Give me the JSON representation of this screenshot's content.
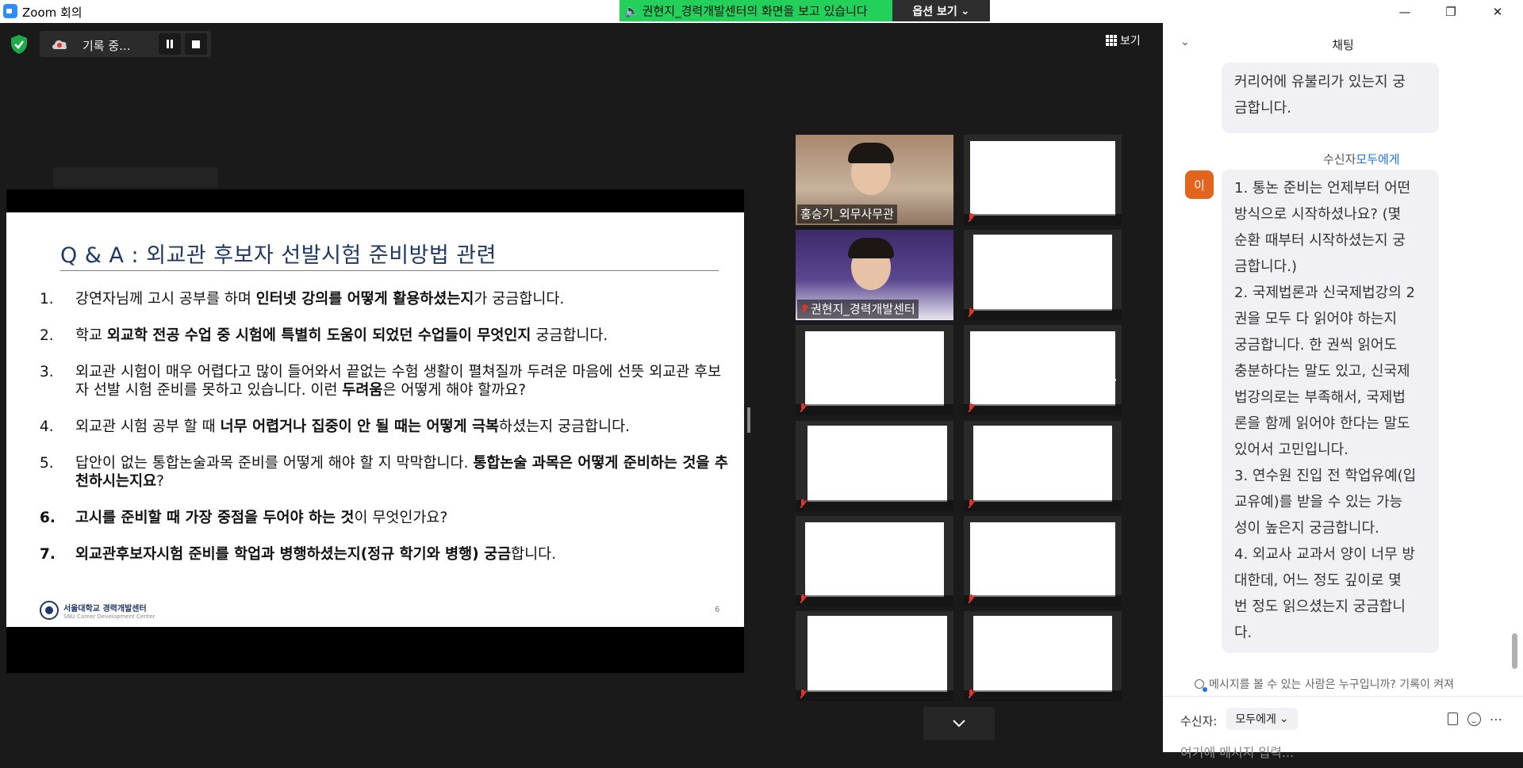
{
  "window": {
    "title": "Zoom 회의",
    "minimize": "—",
    "maximize": "❐",
    "close": "✕"
  },
  "share_banner": {
    "text": "권현지_경력개발센터의 화면을 보고 있습니다",
    "options_label": "옵션 보기"
  },
  "toolbar": {
    "recording_label": "기록 중...",
    "view_label": "보기"
  },
  "slide": {
    "title": "Q & A : 외교관 후보자 선발시험 준비방법 관련",
    "items": [
      {
        "num": "1.",
        "parts": [
          {
            "t": "강연자님께 고시 공부를 하며 ",
            "b": false
          },
          {
            "t": "인터넷 강의를 어떻게 활용하셨는지",
            "b": true
          },
          {
            "t": "가 궁금합니다.",
            "b": false
          }
        ]
      },
      {
        "num": "2.",
        "parts": [
          {
            "t": "학교 ",
            "b": false
          },
          {
            "t": "외교학 전공 수업 중 시험에 특별히 도움이 되었던 수업들이 무엇인지",
            "b": true
          },
          {
            "t": " 궁금합니다.",
            "b": false
          }
        ]
      },
      {
        "num": "3.",
        "parts": [
          {
            "t": "외교관 시험이 매우 어렵다고 많이 들어와서 끝없는 수험 생활이 펼쳐질까 두려운 마음에 선뜻 외교관 후보자 선발 시험 준비를 못하고 있습니다. 이런 ",
            "b": false
          },
          {
            "t": "두려움",
            "b": true
          },
          {
            "t": "은 어떻게 해야 할까요?",
            "b": false
          }
        ]
      },
      {
        "num": "4.",
        "parts": [
          {
            "t": "외교관 시험 공부 할 때 ",
            "b": false
          },
          {
            "t": "너무 어렵거나 집중이 안 될 때는 어떻게 극복",
            "b": true
          },
          {
            "t": "하셨는지 궁금합니다.",
            "b": false
          }
        ]
      },
      {
        "num": "5.",
        "parts": [
          {
            "t": "답안이 없는 통합논술과목 준비를 어떻게 해야 할 지 막막합니다. ",
            "b": false
          },
          {
            "t": "통합논술 과목은 어떻게 준비하는 것을 추천하시는지요",
            "b": true
          },
          {
            "t": "?",
            "b": false
          }
        ]
      },
      {
        "num": "6.",
        "bold_num": true,
        "parts": [
          {
            "t": "고시를 준비할 때 가장 중점을 두어야 하는 것",
            "b": true
          },
          {
            "t": "이 무엇인가요?",
            "b": false
          }
        ]
      },
      {
        "num": "7.",
        "bold_num": true,
        "parts": [
          {
            "t": "외교관후보자시험 준비를 학업과 병행하셨는지(정규 학기와 병행) 궁금",
            "b": true
          },
          {
            "t": "합니다.",
            "b": false
          }
        ]
      }
    ],
    "logo_main": "서울대학교 경력개발센터",
    "logo_sub": "SNU Career Development Center",
    "page_number": "6"
  },
  "gallery": {
    "tiles": [
      {
        "name": "홍승기_외무사무관",
        "has_video": true,
        "active": true
      },
      {
        "name": "",
        "has_video": false
      },
      {
        "name": "권현지_경력개발센터",
        "has_video": true
      },
      {
        "name": "",
        "has_video": false
      },
      {
        "name": "",
        "has_video": false
      },
      {
        "name": "",
        "has_video": false
      },
      {
        "name": "",
        "has_video": false
      },
      {
        "name": "",
        "has_video": false
      },
      {
        "name": "",
        "has_video": false
      },
      {
        "name": "",
        "has_video": false
      },
      {
        "name": "",
        "has_video": false
      },
      {
        "name": "",
        "has_video": false
      }
    ]
  },
  "chat": {
    "title": "채팅",
    "message1_lines": [
      "커리어에 유불리가 있는지 궁",
      "금합니다."
    ],
    "recipient_prefix": "수신자",
    "recipient_to": "모두에게",
    "avatar_initial": "이",
    "message2_lines": [
      "1. 통논 준비는 언제부터 어떤",
      "방식으로 시작하셨나요? (몇",
      "순환 때부터 시작하셨는지 궁",
      "금합니다.)",
      "2. 국제법론과 신국제법강의 2",
      "권을 모두 다 읽어야 하는지",
      "궁금합니다. 한 권씩 읽어도",
      "충분하다는 말도 있고, 신국제",
      "법강의로는 부족해서, 국제법",
      "론을 함께 읽어야 한다는 말도",
      "있어서 고민입니다.",
      "3. 연수원 진입 전 학업유예(입",
      "교유예)를 받을 수 있는 가능",
      "성이 높은지 궁금합니다.",
      "4. 외교사 교과서 양이 너무 방",
      "대한데, 어느 정도 깊이로 몇",
      "번 정도 읽으셨는지 궁금합니",
      "다."
    ],
    "notice": "메시지를 볼 수 있는 사람은 누구입니까? 기록이 켜져",
    "to_label": "수신자:",
    "to_value": "모두에게",
    "input_placeholder": "여기에 메시지 입력..."
  },
  "colors": {
    "banner_green": "#23d05a",
    "active_speaker": "#c6e15a",
    "slide_title": "#1f3864",
    "link_blue": "#1a73e8",
    "avatar_orange": "#e2641d"
  }
}
